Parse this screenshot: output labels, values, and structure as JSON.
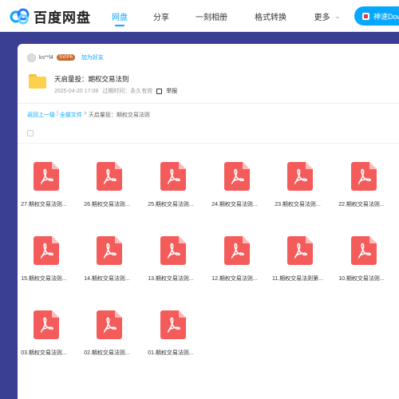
{
  "header": {
    "logo_text": "百度网盘",
    "nav": [
      {
        "label": "网盘",
        "active": true
      },
      {
        "label": "分享",
        "active": false
      },
      {
        "label": "一刻相册",
        "active": false
      },
      {
        "label": "格式转换",
        "active": false
      },
      {
        "label": "更多",
        "active": false
      }
    ],
    "download_label": "神速Dow"
  },
  "share": {
    "username": "ks**l4",
    "vip_badge": "SVIP6",
    "add_friend": "加为好友",
    "title": "天启量投：期权交易法则",
    "date": "2025-04-20 17:08",
    "expire_label": "过期时间：永久有效",
    "report_label": "举报"
  },
  "breadcrumb": {
    "back": "返回上一级",
    "sep": "|",
    "all_files": "全部文件",
    "arrow": ">",
    "current": "天启量投：期权交易法则"
  },
  "files": [
    {
      "name": "27.期权交易法则..."
    },
    {
      "name": "26.期权交易法则..."
    },
    {
      "name": "25.期权交易法则..."
    },
    {
      "name": "24.期权交易法则..."
    },
    {
      "name": "23.期权交易法则..."
    },
    {
      "name": "22.期权交易法则..."
    },
    {
      "name": "15.期权交易法则..."
    },
    {
      "name": "14.期权交易法则..."
    },
    {
      "name": "13.期权交易法则..."
    },
    {
      "name": "12.期权交易法则..."
    },
    {
      "name": "11.期权交易法则第..."
    },
    {
      "name": "10.期权交易法则..."
    },
    {
      "name": "03.期权交易法则..."
    },
    {
      "name": "02.期权交易法则..."
    },
    {
      "name": "01.期权交易法则..."
    }
  ],
  "colors": {
    "accent": "#06a7ff",
    "pdf": "#f45b5b",
    "background": "#3a3f93"
  }
}
